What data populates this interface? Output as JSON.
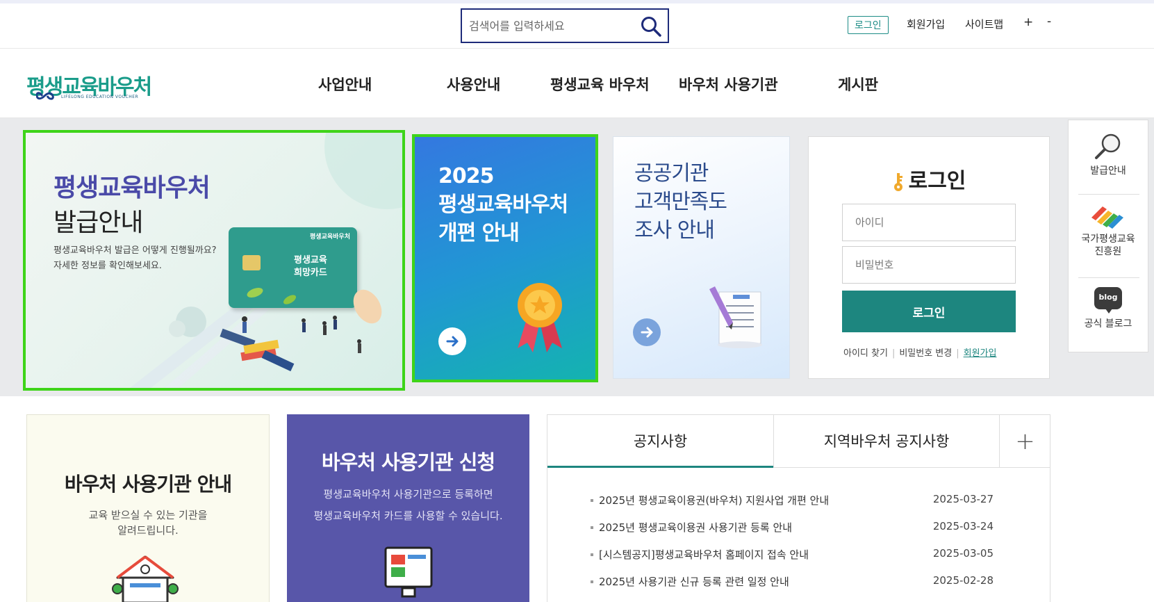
{
  "topbar": {
    "search_placeholder": "검색어를 입력하세요",
    "login": "로그인",
    "signup": "회원가입",
    "sitemap": "사이트맵",
    "zoom_in": "+",
    "zoom_out": "-"
  },
  "logo": {
    "title": "평생교육바우처",
    "subtitle": "LIFELONG EDUCATION VOUCHER"
  },
  "nav": [
    "사업안내",
    "사용안내",
    "평생교육 바우처",
    "바우처 사용기관",
    "게시판"
  ],
  "banners": {
    "main": {
      "title1": "평생교육바우처",
      "title2": "발급안내",
      "desc1": "평생교육바우처 발급은 어떻게 진행될까요?",
      "desc2": "자세한 정보를 확인해보세요.",
      "card_brand": "평생교육바우처",
      "card_name1": "평생교육",
      "card_name2": "희망카드"
    },
    "reform": {
      "line1": "2025",
      "line2": "평생교육바우처",
      "line3": "개편 안내"
    },
    "survey": {
      "line1": "공공기관",
      "line2": "고객만족도",
      "line3": "조사 안내"
    }
  },
  "login": {
    "title": "로그인",
    "id_placeholder": "아이디",
    "pw_placeholder": "비밀번호",
    "button": "로그인",
    "find_id": "아이디 찾기",
    "change_pw": "비밀번호 변경",
    "join": "회원가입"
  },
  "quick_menu": {
    "issue": "발급안내",
    "nile_line1": "국가평생교육",
    "nile_line2": "진흥원",
    "blog_badge": "blog",
    "blog": "공식 블로그"
  },
  "venue": {
    "title": "바우처 사용기관 안내",
    "desc1": "교육 받으실 수 있는 기관을",
    "desc2": "알려드립니다."
  },
  "apply": {
    "title": "바우처 사용기관 신청",
    "desc1": "평생교육바우처 사용기관으로 등록하면",
    "desc2": "평생교육바우처 카드를 사용할 수 있습니다."
  },
  "notice": {
    "tabs": [
      "공지사항",
      "지역바우처 공지사항"
    ],
    "more": "+",
    "items": [
      {
        "title": "2025년 평생교육이용권(바우처) 지원사업 개편 안내",
        "date": "2025-03-27"
      },
      {
        "title": "2025년 평생교육이용권 사용기관 등록 안내",
        "date": "2025-03-24"
      },
      {
        "title": "[시스템공지]평생교육바우처 홈페이지 접속 안내",
        "date": "2025-03-05"
      },
      {
        "title": "2025년 사용기관 신규 등록 관련 일정 안내",
        "date": "2025-02-28"
      }
    ]
  },
  "colors": {
    "brand_teal": "#1d867f",
    "nav_highlight": "#3ed419",
    "purple": "#5856a9",
    "search_border": "#1e2b7a"
  }
}
